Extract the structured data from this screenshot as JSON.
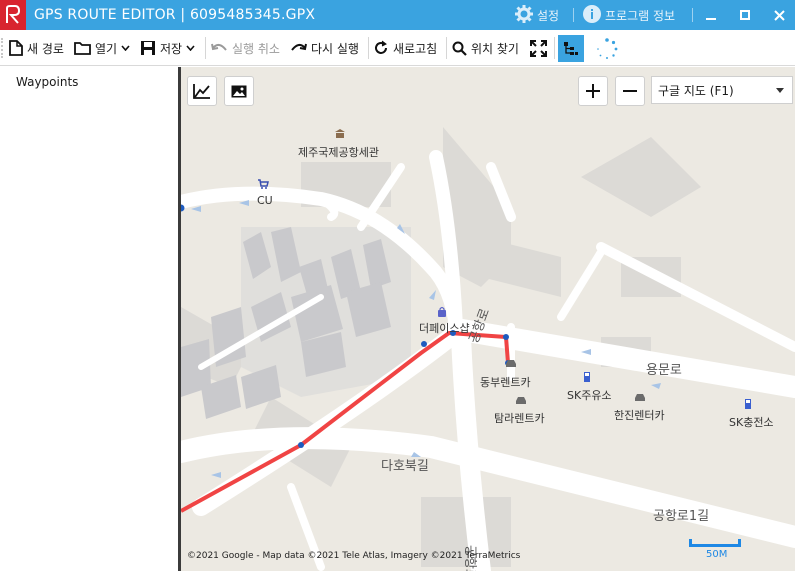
{
  "window": {
    "title": "GPS ROUTE EDITOR | 6095485345.GPX",
    "settings_label": "설정",
    "program_info_label": "프로그램 정보"
  },
  "toolbar": {
    "new_route": "새 경로",
    "open": "열기",
    "save": "저장",
    "undo": "실행 취소",
    "redo": "다시 실행",
    "refresh": "새로고침",
    "find_location": "위치 찾기"
  },
  "sidebar": {
    "title": "Waypoints"
  },
  "map": {
    "map_type_selected": "구글 지도 (F1)",
    "labels": {
      "customs": "제주국제공항세관",
      "cu": "CU",
      "theplace": "더페이스샵",
      "dongbu": "동부렌트카",
      "sk_gas": "SK주유소",
      "tamra": "탐라렌트카",
      "hanjin": "한진렌터카",
      "sk_charge": "SK충전소",
      "yongmun": "용문로",
      "dahobuk": "다호북길",
      "gonghang1": "공항로1길",
      "gonghang_v": "공항로",
      "road_v2": "공항로"
    },
    "attribution": "©2021 Google - Map data ©2021 Tele Atlas, Imagery ©2021 TerraMetrics",
    "scale_label": "50M",
    "route_color": "#f04444",
    "waypoint_color": "#1e5bbf"
  },
  "colors": {
    "titlebar": "#3aa3e0",
    "logo": "#d8242f"
  }
}
